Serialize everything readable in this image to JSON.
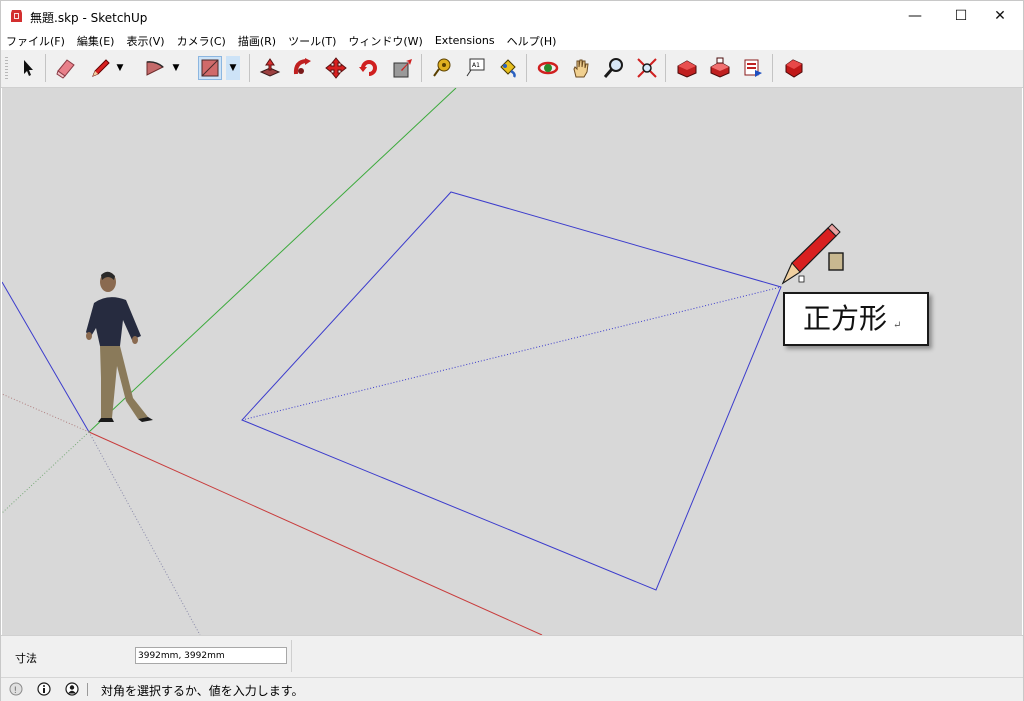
{
  "window": {
    "title": "無題.skp - SketchUp",
    "minimize_glyph": "—",
    "maximize_glyph": "☐",
    "close_glyph": "✕"
  },
  "menu": [
    "ファイル(F)",
    "編集(E)",
    "表示(V)",
    "カメラ(C)",
    "描画(R)",
    "ツール(T)",
    "ウィンドウ(W)",
    "Extensions",
    "ヘルプ(H)"
  ],
  "toolbar": {
    "tools": [
      {
        "icon": "select-arrow-icon"
      },
      {
        "icon": "eraser-icon"
      },
      {
        "icon": "pencil-line-icon"
      },
      {
        "icon": "arc-icon"
      },
      {
        "icon": "rectangle-icon",
        "active": true
      },
      {
        "icon": "push-pull-icon"
      },
      {
        "icon": "follow-me-icon"
      },
      {
        "icon": "move-icon"
      },
      {
        "icon": "rotate-icon"
      },
      {
        "icon": "scale-icon"
      },
      {
        "icon": "tape-measure-icon"
      },
      {
        "icon": "text-icon"
      },
      {
        "icon": "paint-bucket-icon"
      },
      {
        "icon": "orbit-icon"
      },
      {
        "icon": "pan-hand-icon"
      },
      {
        "icon": "zoom-icon"
      },
      {
        "icon": "zoom-extents-icon"
      },
      {
        "icon": "warehouse-icon"
      },
      {
        "icon": "share-model-icon"
      },
      {
        "icon": "upload-icon"
      },
      {
        "icon": "extension-warehouse-icon"
      }
    ],
    "dropdown_glyph": "▼"
  },
  "viewport": {
    "tooltip_text": "正方形",
    "tooltip_return_glyph": "↵",
    "colors": {
      "background": "#d8d8d8",
      "edge_blue": "#3c3ccc",
      "axis_green": "#3caa3c",
      "axis_red": "#c83c3c"
    }
  },
  "vcb": {
    "label": "寸法",
    "value": "3992mm, 3992mm"
  },
  "status": {
    "message": "対角を選択するか、値を入力します。",
    "icons": [
      "geo-location-icon",
      "info-icon",
      "user-icon"
    ]
  }
}
